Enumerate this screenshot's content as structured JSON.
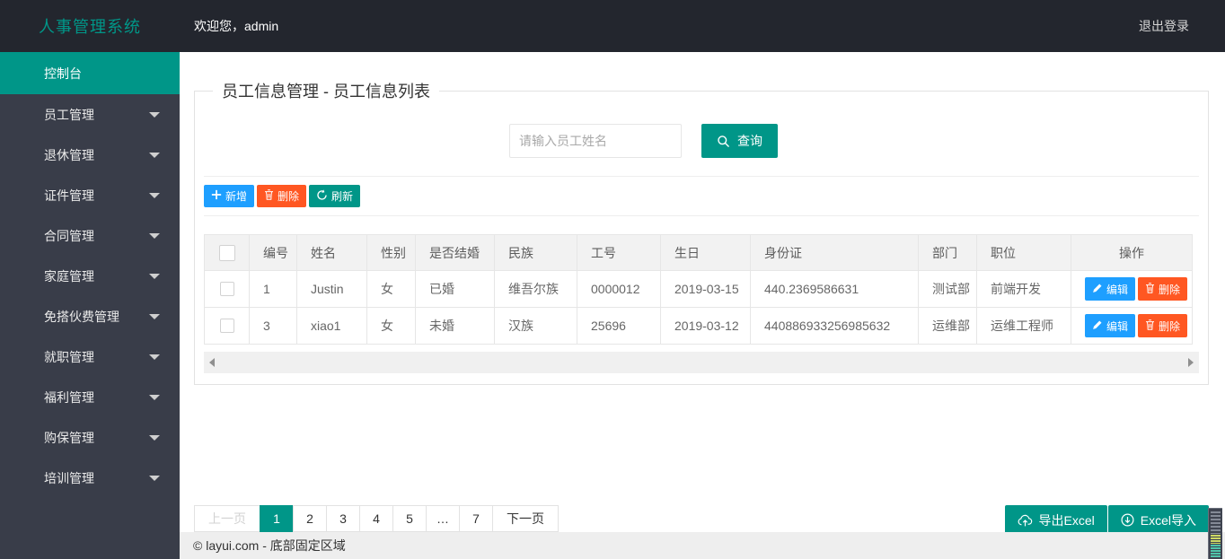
{
  "header": {
    "app_title": "人事管理系统",
    "welcome": "欢迎您，admin",
    "logout": "退出登录"
  },
  "sidebar": {
    "items": [
      {
        "id": "console",
        "label": "控制台",
        "active": true,
        "arrow": false
      },
      {
        "id": "employee",
        "label": "员工管理",
        "arrow": true
      },
      {
        "id": "retirement",
        "label": "退休管理",
        "arrow": true
      },
      {
        "id": "certificate",
        "label": "证件管理",
        "arrow": true
      },
      {
        "id": "contract",
        "label": "合同管理",
        "arrow": true
      },
      {
        "id": "family",
        "label": "家庭管理",
        "arrow": true
      },
      {
        "id": "meal-fee",
        "label": "免搭伙费管理",
        "arrow": true
      },
      {
        "id": "employment",
        "label": "就职管理",
        "arrow": true
      },
      {
        "id": "welfare",
        "label": "福利管理",
        "arrow": true
      },
      {
        "id": "insurance",
        "label": "购保管理",
        "arrow": true
      },
      {
        "id": "training",
        "label": "培训管理",
        "arrow": true
      }
    ]
  },
  "main": {
    "legend": "员工信息管理 - 员工信息列表",
    "search": {
      "placeholder": "请输入员工姓名",
      "button": "查询",
      "icon": "search-icon"
    },
    "toolbar": [
      {
        "id": "add",
        "label": "新增",
        "icon": "plus-icon",
        "style": "bg-blue"
      },
      {
        "id": "delete",
        "label": "删除",
        "icon": "trash-icon",
        "style": "bg-red"
      },
      {
        "id": "refresh",
        "label": "刷新",
        "icon": "refresh-icon",
        "style": "bg-teal"
      }
    ],
    "table": {
      "columns": [
        "编号",
        "姓名",
        "性别",
        "是否结婚",
        "民族",
        "工号",
        "生日",
        "身份证",
        "部门",
        "职位",
        "操作"
      ],
      "rows": [
        {
          "cells": [
            "1",
            "Justin",
            "女",
            "已婚",
            "维吾尔族",
            "0000012",
            "2019-03-15",
            "440.2369586631",
            "测试部",
            "前端开发"
          ]
        },
        {
          "cells": [
            "3",
            "xiao1",
            "女",
            "未婚",
            "汉族",
            "25696",
            "2019-03-12",
            "440886933256985632",
            "运维部",
            "运维工程师"
          ]
        }
      ],
      "actions": {
        "edit": "编辑",
        "delete": "删除"
      }
    },
    "pagination": {
      "prev": "上一页",
      "pages": [
        "1",
        "2",
        "3",
        "4",
        "5",
        "…",
        "7"
      ],
      "active_page": "1",
      "next": "下一页"
    },
    "excel": {
      "export_label": "导出Excel",
      "import_label": "Excel导入"
    }
  },
  "footer": {
    "copyright": "© layui.com - 底部固定区域"
  },
  "colors": {
    "accent": "#009688",
    "blue": "#1E9FFF",
    "red": "#FF5722",
    "header_bg": "#23262E",
    "sidebar_bg": "#393D49"
  }
}
